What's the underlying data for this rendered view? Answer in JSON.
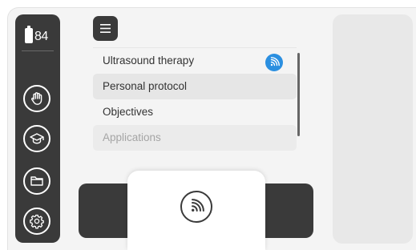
{
  "sidebar": {
    "battery_level": "84",
    "buttons": [
      {
        "icon": "hand-icon"
      },
      {
        "icon": "graduation-cap-icon"
      },
      {
        "icon": "folder-icon"
      },
      {
        "icon": "gear-icon"
      }
    ]
  },
  "menu": {
    "items": [
      {
        "label": "Ultrasound therapy",
        "badge_icon": "ultrasound-wave-icon"
      },
      {
        "label": "Personal protocol"
      },
      {
        "label": "Objectives"
      },
      {
        "label": "Applications"
      }
    ]
  },
  "bottom": {
    "action_icon": "ultrasound-wave-icon"
  },
  "colors": {
    "dark": "#3a3a3a",
    "accent": "#2b8fe0",
    "background": "#f4f4f4"
  }
}
